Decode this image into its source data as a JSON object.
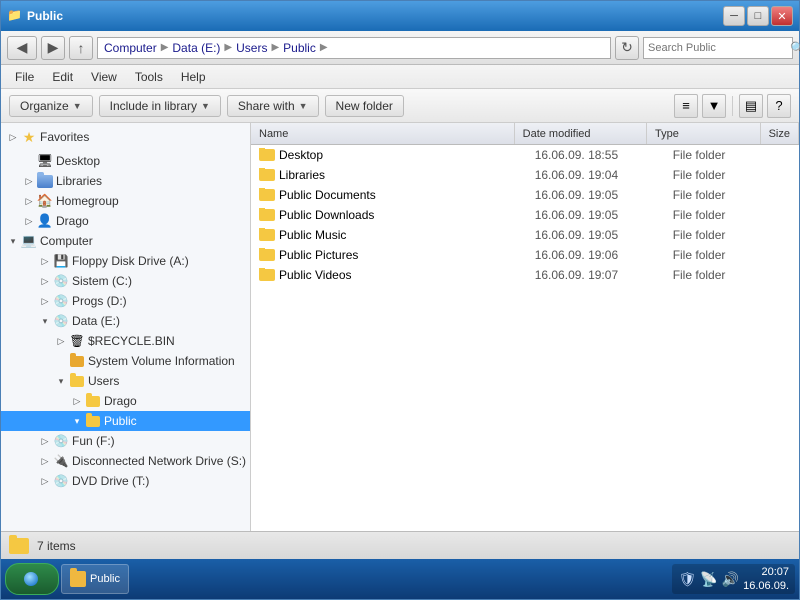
{
  "window": {
    "title": "Public",
    "title_icon": "📁"
  },
  "address": {
    "path": [
      "Computer",
      "Data (E:)",
      "Users",
      "Public"
    ],
    "search_placeholder": "Search Public",
    "refresh_tooltip": "Refresh"
  },
  "menu": {
    "items": [
      "File",
      "Edit",
      "View",
      "Tools",
      "Help"
    ]
  },
  "toolbar": {
    "organize_label": "Organize",
    "library_label": "Include in library",
    "share_label": "Share with",
    "new_folder_label": "New folder"
  },
  "sidebar": {
    "favorites_label": "Favorites",
    "desktop_label": "Desktop",
    "libraries_label": "Libraries",
    "homegroup_label": "Homegroup",
    "drago_label": "Drago",
    "computer_label": "Computer",
    "floppy_label": "Floppy Disk Drive (A:)",
    "sistem_label": "Sistem (C:)",
    "progs_label": "Progs (D:)",
    "data_label": "Data (E:)",
    "recycle_label": "$RECYCLE.BIN",
    "sysvolinfo_label": "System Volume Information",
    "users_label": "Users",
    "drago2_label": "Drago",
    "public_label": "Public",
    "fun_label": "Fun (F:)",
    "disconnected_label": "Disconnected Network Drive (S:)",
    "dvd_label": "DVD Drive (T:)"
  },
  "file_list": {
    "columns": [
      "Name",
      "Date modified",
      "Type",
      "Size"
    ],
    "items": [
      {
        "name": "Desktop",
        "date": "16.06.09. 18:55",
        "type": "File folder",
        "size": ""
      },
      {
        "name": "Libraries",
        "date": "16.06.09. 19:04",
        "type": "File folder",
        "size": ""
      },
      {
        "name": "Public Documents",
        "date": "16.06.09. 19:05",
        "type": "File folder",
        "size": ""
      },
      {
        "name": "Public Downloads",
        "date": "16.06.09. 19:05",
        "type": "File folder",
        "size": ""
      },
      {
        "name": "Public Music",
        "date": "16.06.09. 19:05",
        "type": "File folder",
        "size": ""
      },
      {
        "name": "Public Pictures",
        "date": "16.06.09. 19:06",
        "type": "File folder",
        "size": ""
      },
      {
        "name": "Public Videos",
        "date": "16.06.09. 19:07",
        "type": "File folder",
        "size": ""
      }
    ]
  },
  "status_bar": {
    "item_count": "7 items"
  },
  "taskbar": {
    "start_label": "Start",
    "window_btn_label": "Public",
    "time": "20:07",
    "date": "16.06.09."
  }
}
